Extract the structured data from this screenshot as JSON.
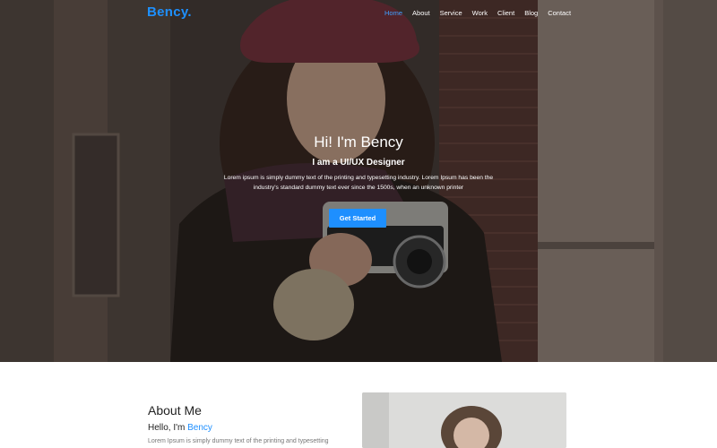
{
  "brand": "Bency.",
  "nav": {
    "items": [
      "Home",
      "About",
      "Service",
      "Work",
      "Client",
      "Blog",
      "Contact"
    ]
  },
  "hero": {
    "title": "Hi! I'm Bency",
    "subtitle": "I am a UI/UX Designer",
    "description": "Lorem ipsum is simply dummy text of the printing and typesetting industry. Lorem Ipsum has been the industry's standard dummy text ever since the 1500s, when an unknown printer",
    "button_label": "Get Started"
  },
  "about": {
    "title": "About Me",
    "hello_prefix": "Hello, I'm ",
    "hello_name": "Bency",
    "text": "Lorem Ipsum is simply dummy text of the printing and typesetting"
  },
  "colors": {
    "accent": "#1e8fff"
  }
}
